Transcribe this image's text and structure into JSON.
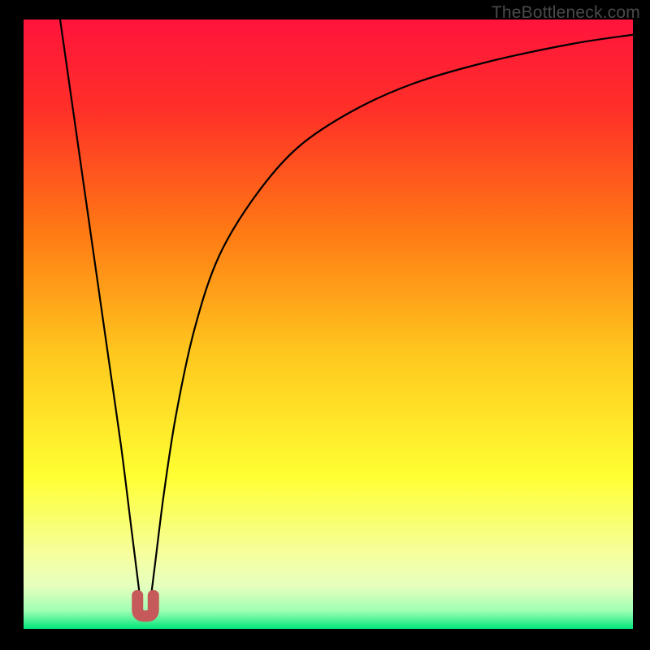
{
  "watermark": "TheBottleneck.com",
  "chart_data": {
    "type": "line",
    "title": "",
    "xlabel": "",
    "ylabel": "",
    "xlim": [
      0,
      100
    ],
    "ylim": [
      0,
      100
    ],
    "grid": false,
    "legend": false,
    "background_gradient": {
      "stops": [
        {
          "pos": 0.0,
          "color": "#ff143c"
        },
        {
          "pos": 0.15,
          "color": "#ff3028"
        },
        {
          "pos": 0.35,
          "color": "#ff7a14"
        },
        {
          "pos": 0.55,
          "color": "#ffc81e"
        },
        {
          "pos": 0.75,
          "color": "#ffff32"
        },
        {
          "pos": 0.88,
          "color": "#f5ffa0"
        },
        {
          "pos": 0.93,
          "color": "#e6ffbe"
        },
        {
          "pos": 0.97,
          "color": "#a0ffb4"
        },
        {
          "pos": 1.0,
          "color": "#00e67a"
        }
      ]
    },
    "series": [
      {
        "name": "bottleneck-curve",
        "x": [
          6,
          8,
          10,
          12,
          14,
          16,
          17.5,
          18.5,
          19.3,
          20,
          20.7,
          21.5,
          23,
          25,
          28,
          32,
          38,
          45,
          54,
          64,
          76,
          90,
          100
        ],
        "y": [
          100,
          86,
          72,
          58,
          44,
          30,
          18,
          10,
          4,
          2,
          4,
          10,
          22,
          35,
          49,
          61,
          71,
          79,
          85,
          89.5,
          93,
          96,
          97.5
        ]
      }
    ],
    "marker": {
      "name": "optimal-point",
      "shape": "u",
      "color": "#c65a5a",
      "x": 20,
      "y": 3,
      "width_x": 2.6,
      "height_y": 4.5
    }
  }
}
